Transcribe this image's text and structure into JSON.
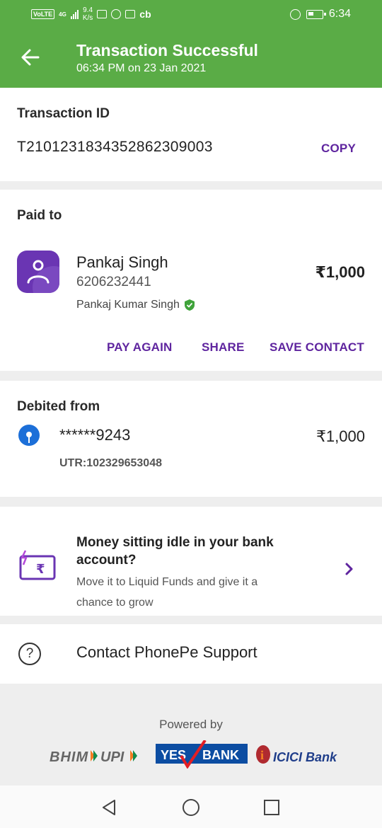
{
  "status_bar": {
    "volte": "VoLTE",
    "network": "4G",
    "speed_value": "9.4",
    "speed_unit": "K/s",
    "carrier_icon": "cb",
    "time": "6:34",
    "icons": [
      "message-icon",
      "chat-icon",
      "app-icon",
      "alarm-icon",
      "battery-icon"
    ]
  },
  "header": {
    "title": "Transaction Successful",
    "subtitle": "06:34 PM on 23 Jan 2021",
    "color": "#5aac46"
  },
  "transaction": {
    "label": "Transaction ID",
    "id": "T2101231834352862309003",
    "copy_label": "COPY"
  },
  "paid_to": {
    "label": "Paid to",
    "name": "Pankaj Singh",
    "phone": "6206232441",
    "verified_name": "Pankaj Kumar Singh",
    "amount": "₹1,000",
    "actions": {
      "pay_again": "PAY AGAIN",
      "share": "SHARE",
      "save_contact": "SAVE CONTACT"
    }
  },
  "debited_from": {
    "label": "Debited from",
    "account": "******9243",
    "amount": "₹1,000",
    "utr": "UTR:102329653048"
  },
  "promo": {
    "title": "Money sitting idle in your bank account?",
    "body": "Move it to Liquid Funds and give it a chance to grow"
  },
  "support": {
    "label": "Contact PhonePe Support"
  },
  "footer": {
    "powered_by": "Powered by",
    "bhim": "BHIM",
    "upi": "UPI",
    "yes": "YES",
    "bank": "BANK",
    "icici": "ICICI Bank"
  },
  "accent_color": "#5f259f"
}
